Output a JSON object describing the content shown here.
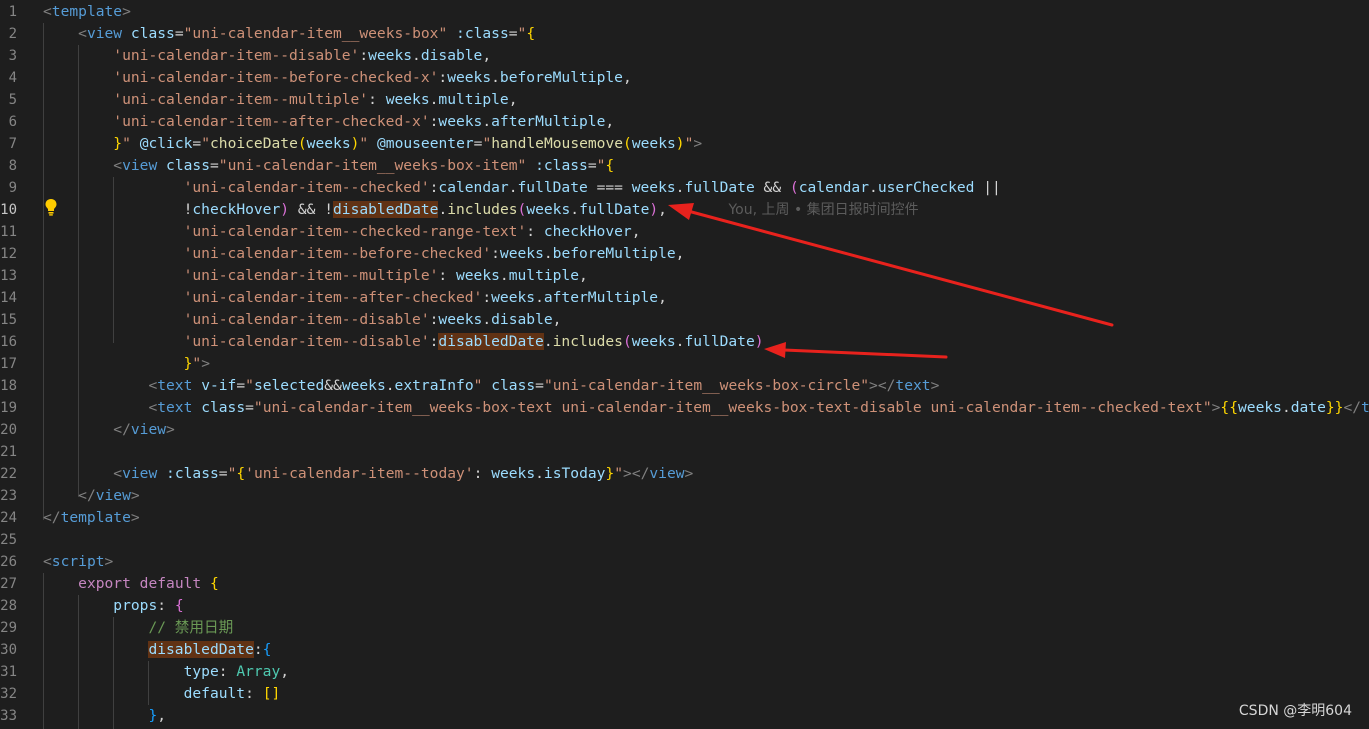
{
  "editor": {
    "active_line": "10",
    "blame_annotation": "You, 上周 • 集团日报时间控件",
    "watermark": "CSDN @李明604",
    "highlight_color": "#613214",
    "arrow_color": "#e8221d",
    "lines": [
      {
        "n": "1",
        "tokens": [
          [
            "t-punc",
            "<"
          ],
          [
            "t-tag",
            "template"
          ],
          [
            "t-punc",
            ">"
          ]
        ]
      },
      {
        "n": "2",
        "tokens": [
          [
            "t-text",
            "    "
          ],
          [
            "t-punc",
            "<"
          ],
          [
            "t-tag",
            "view"
          ],
          [
            "t-text",
            " "
          ],
          [
            "t-attr",
            "class"
          ],
          [
            "t-text",
            "="
          ],
          [
            "t-str",
            "\"uni-calendar-item__weeks-box\""
          ],
          [
            "t-text",
            " "
          ],
          [
            "t-attr",
            ":class"
          ],
          [
            "t-text",
            "="
          ],
          [
            "t-str",
            "\""
          ],
          [
            "t-br1",
            "{"
          ]
        ]
      },
      {
        "n": "3",
        "tokens": [
          [
            "t-text",
            "        "
          ],
          [
            "t-str",
            "'uni-calendar-item--disable'"
          ],
          [
            "t-text",
            ":"
          ],
          [
            "t-var",
            "weeks"
          ],
          [
            "t-text",
            "."
          ],
          [
            "t-prop",
            "disable"
          ],
          [
            "t-text",
            ","
          ]
        ]
      },
      {
        "n": "4",
        "tokens": [
          [
            "t-text",
            "        "
          ],
          [
            "t-str",
            "'uni-calendar-item--before-checked-x'"
          ],
          [
            "t-text",
            ":"
          ],
          [
            "t-var",
            "weeks"
          ],
          [
            "t-text",
            "."
          ],
          [
            "t-prop",
            "beforeMultiple"
          ],
          [
            "t-text",
            ","
          ]
        ]
      },
      {
        "n": "5",
        "tokens": [
          [
            "t-text",
            "        "
          ],
          [
            "t-str",
            "'uni-calendar-item--multiple'"
          ],
          [
            "t-text",
            ": "
          ],
          [
            "t-var",
            "weeks"
          ],
          [
            "t-text",
            "."
          ],
          [
            "t-prop",
            "multiple"
          ],
          [
            "t-text",
            ","
          ]
        ]
      },
      {
        "n": "6",
        "tokens": [
          [
            "t-text",
            "        "
          ],
          [
            "t-str",
            "'uni-calendar-item--after-checked-x'"
          ],
          [
            "t-text",
            ":"
          ],
          [
            "t-var",
            "weeks"
          ],
          [
            "t-text",
            "."
          ],
          [
            "t-prop",
            "afterMultiple"
          ],
          [
            "t-text",
            ","
          ]
        ]
      },
      {
        "n": "7",
        "tokens": [
          [
            "t-text",
            "        "
          ],
          [
            "t-br1",
            "}"
          ],
          [
            "t-str",
            "\""
          ],
          [
            "t-text",
            " "
          ],
          [
            "t-attr",
            "@click"
          ],
          [
            "t-text",
            "="
          ],
          [
            "t-str",
            "\""
          ],
          [
            "t-fn",
            "choiceDate"
          ],
          [
            "t-br1",
            "("
          ],
          [
            "t-var",
            "weeks"
          ],
          [
            "t-br1",
            ")"
          ],
          [
            "t-str",
            "\""
          ],
          [
            "t-text",
            " "
          ],
          [
            "t-attr",
            "@mouseenter"
          ],
          [
            "t-text",
            "="
          ],
          [
            "t-str",
            "\""
          ],
          [
            "t-fn",
            "handleMousemove"
          ],
          [
            "t-br1",
            "("
          ],
          [
            "t-var",
            "weeks"
          ],
          [
            "t-br1",
            ")"
          ],
          [
            "t-str",
            "\""
          ],
          [
            "t-punc",
            ">"
          ]
        ]
      },
      {
        "n": "8",
        "tokens": [
          [
            "t-text",
            "        "
          ],
          [
            "t-punc",
            "<"
          ],
          [
            "t-tag",
            "view"
          ],
          [
            "t-text",
            " "
          ],
          [
            "t-attr",
            "class"
          ],
          [
            "t-text",
            "="
          ],
          [
            "t-str",
            "\"uni-calendar-item__weeks-box-item\""
          ],
          [
            "t-text",
            " "
          ],
          [
            "t-attr",
            ":class"
          ],
          [
            "t-text",
            "="
          ],
          [
            "t-str",
            "\""
          ],
          [
            "t-br1",
            "{"
          ]
        ]
      },
      {
        "n": "9",
        "tokens": [
          [
            "t-text",
            "                "
          ],
          [
            "t-str",
            "'uni-calendar-item--checked'"
          ],
          [
            "t-text",
            ":"
          ],
          [
            "t-var",
            "calendar"
          ],
          [
            "t-text",
            "."
          ],
          [
            "t-prop",
            "fullDate"
          ],
          [
            "t-text",
            " === "
          ],
          [
            "t-var",
            "weeks"
          ],
          [
            "t-text",
            "."
          ],
          [
            "t-prop",
            "fullDate"
          ],
          [
            "t-text",
            " && "
          ],
          [
            "t-br2",
            "("
          ],
          [
            "t-var",
            "calendar"
          ],
          [
            "t-text",
            "."
          ],
          [
            "t-prop",
            "userChecked"
          ],
          [
            "t-text",
            " ||"
          ]
        ]
      },
      {
        "n": "10",
        "tokens": [
          [
            "t-text",
            "                "
          ],
          [
            "t-text",
            "!"
          ],
          [
            "t-var",
            "checkHover"
          ],
          [
            "t-br2",
            ")"
          ],
          [
            "t-text",
            " && !"
          ],
          [
            "t-var t-hl",
            "disabledDate"
          ],
          [
            "t-text",
            "."
          ],
          [
            "t-fn",
            "includes"
          ],
          [
            "t-br2",
            "("
          ],
          [
            "t-var",
            "weeks"
          ],
          [
            "t-text",
            "."
          ],
          [
            "t-prop",
            "fullDate"
          ],
          [
            "t-br2",
            ")"
          ],
          [
            "t-text",
            ","
          ],
          [
            "t-text",
            "       "
          ],
          [
            "blame",
            "You, 上周 • 集团日报时间控件"
          ]
        ]
      },
      {
        "n": "11",
        "tokens": [
          [
            "t-text",
            "                "
          ],
          [
            "t-str",
            "'uni-calendar-item--checked-range-text'"
          ],
          [
            "t-text",
            ": "
          ],
          [
            "t-var",
            "checkHover"
          ],
          [
            "t-text",
            ","
          ]
        ]
      },
      {
        "n": "12",
        "tokens": [
          [
            "t-text",
            "                "
          ],
          [
            "t-str",
            "'uni-calendar-item--before-checked'"
          ],
          [
            "t-text",
            ":"
          ],
          [
            "t-var",
            "weeks"
          ],
          [
            "t-text",
            "."
          ],
          [
            "t-prop",
            "beforeMultiple"
          ],
          [
            "t-text",
            ","
          ]
        ]
      },
      {
        "n": "13",
        "tokens": [
          [
            "t-text",
            "                "
          ],
          [
            "t-str",
            "'uni-calendar-item--multiple'"
          ],
          [
            "t-text",
            ": "
          ],
          [
            "t-var",
            "weeks"
          ],
          [
            "t-text",
            "."
          ],
          [
            "t-prop",
            "multiple"
          ],
          [
            "t-text",
            ","
          ]
        ]
      },
      {
        "n": "14",
        "tokens": [
          [
            "t-text",
            "                "
          ],
          [
            "t-str",
            "'uni-calendar-item--after-checked'"
          ],
          [
            "t-text",
            ":"
          ],
          [
            "t-var",
            "weeks"
          ],
          [
            "t-text",
            "."
          ],
          [
            "t-prop",
            "afterMultiple"
          ],
          [
            "t-text",
            ","
          ]
        ]
      },
      {
        "n": "15",
        "tokens": [
          [
            "t-text",
            "                "
          ],
          [
            "t-str",
            "'uni-calendar-item--disable'"
          ],
          [
            "t-text",
            ":"
          ],
          [
            "t-var",
            "weeks"
          ],
          [
            "t-text",
            "."
          ],
          [
            "t-prop",
            "disable"
          ],
          [
            "t-text",
            ","
          ]
        ]
      },
      {
        "n": "16",
        "tokens": [
          [
            "t-text",
            "                "
          ],
          [
            "t-str",
            "'uni-calendar-item--disable'"
          ],
          [
            "t-text",
            ":"
          ],
          [
            "t-var t-hl",
            "disabledDate"
          ],
          [
            "t-text",
            "."
          ],
          [
            "t-fn",
            "includes"
          ],
          [
            "t-br2",
            "("
          ],
          [
            "t-var",
            "weeks"
          ],
          [
            "t-text",
            "."
          ],
          [
            "t-prop",
            "fullDate"
          ],
          [
            "t-br2",
            ")"
          ]
        ]
      },
      {
        "n": "17",
        "tokens": [
          [
            "t-text",
            "                "
          ],
          [
            "t-br1",
            "}"
          ],
          [
            "t-str",
            "\""
          ],
          [
            "t-punc",
            ">"
          ]
        ]
      },
      {
        "n": "18",
        "tokens": [
          [
            "t-text",
            "            "
          ],
          [
            "t-punc",
            "<"
          ],
          [
            "t-tag",
            "text"
          ],
          [
            "t-text",
            " "
          ],
          [
            "t-attr",
            "v-if"
          ],
          [
            "t-text",
            "="
          ],
          [
            "t-str",
            "\""
          ],
          [
            "t-var",
            "selected"
          ],
          [
            "t-text",
            "&&"
          ],
          [
            "t-var",
            "weeks"
          ],
          [
            "t-text",
            "."
          ],
          [
            "t-prop",
            "extraInfo"
          ],
          [
            "t-str",
            "\""
          ],
          [
            "t-text",
            " "
          ],
          [
            "t-attr",
            "class"
          ],
          [
            "t-text",
            "="
          ],
          [
            "t-str",
            "\"uni-calendar-item__weeks-box-circle\""
          ],
          [
            "t-punc",
            "></"
          ],
          [
            "t-tag",
            "text"
          ],
          [
            "t-punc",
            ">"
          ]
        ]
      },
      {
        "n": "19",
        "tokens": [
          [
            "t-text",
            "            "
          ],
          [
            "t-punc",
            "<"
          ],
          [
            "t-tag",
            "text"
          ],
          [
            "t-text",
            " "
          ],
          [
            "t-attr",
            "class"
          ],
          [
            "t-text",
            "="
          ],
          [
            "t-str",
            "\"uni-calendar-item__weeks-box-text uni-calendar-item__weeks-box-text-disable uni-calendar-item--checked-text\""
          ],
          [
            "t-punc",
            ">"
          ],
          [
            "t-br1",
            "{{"
          ],
          [
            "t-var",
            "weeks"
          ],
          [
            "t-text",
            "."
          ],
          [
            "t-prop",
            "date"
          ],
          [
            "t-br1",
            "}}"
          ],
          [
            "t-punc",
            "</"
          ],
          [
            "t-tag",
            "text"
          ],
          [
            "t-punc",
            ">"
          ]
        ]
      },
      {
        "n": "20",
        "tokens": [
          [
            "t-text",
            "        "
          ],
          [
            "t-punc",
            "</"
          ],
          [
            "t-tag",
            "view"
          ],
          [
            "t-punc",
            ">"
          ]
        ]
      },
      {
        "n": "21",
        "tokens": []
      },
      {
        "n": "22",
        "tokens": [
          [
            "t-text",
            "        "
          ],
          [
            "t-punc",
            "<"
          ],
          [
            "t-tag",
            "view"
          ],
          [
            "t-text",
            " "
          ],
          [
            "t-attr",
            ":class"
          ],
          [
            "t-text",
            "="
          ],
          [
            "t-str",
            "\""
          ],
          [
            "t-br1",
            "{"
          ],
          [
            "t-str",
            "'uni-calendar-item--today'"
          ],
          [
            "t-text",
            ": "
          ],
          [
            "t-var",
            "weeks"
          ],
          [
            "t-text",
            "."
          ],
          [
            "t-prop",
            "isToday"
          ],
          [
            "t-br1",
            "}"
          ],
          [
            "t-str",
            "\""
          ],
          [
            "t-punc",
            "></"
          ],
          [
            "t-tag",
            "view"
          ],
          [
            "t-punc",
            ">"
          ]
        ]
      },
      {
        "n": "23",
        "tokens": [
          [
            "t-text",
            "    "
          ],
          [
            "t-punc",
            "</"
          ],
          [
            "t-tag",
            "view"
          ],
          [
            "t-punc",
            ">"
          ]
        ]
      },
      {
        "n": "24",
        "tokens": [
          [
            "t-punc",
            "</"
          ],
          [
            "t-tag",
            "template"
          ],
          [
            "t-punc",
            ">"
          ]
        ]
      },
      {
        "n": "25",
        "tokens": []
      },
      {
        "n": "26",
        "tokens": [
          [
            "t-punc",
            "<"
          ],
          [
            "t-tag",
            "script"
          ],
          [
            "t-punc",
            ">"
          ]
        ]
      },
      {
        "n": "27",
        "tokens": [
          [
            "t-text",
            "    "
          ],
          [
            "t-kw",
            "export"
          ],
          [
            "t-text",
            " "
          ],
          [
            "t-kw",
            "default"
          ],
          [
            "t-text",
            " "
          ],
          [
            "t-br1",
            "{"
          ]
        ]
      },
      {
        "n": "28",
        "tokens": [
          [
            "t-text",
            "        "
          ],
          [
            "t-var",
            "props"
          ],
          [
            "t-text",
            ": "
          ],
          [
            "t-br2",
            "{"
          ]
        ]
      },
      {
        "n": "29",
        "tokens": [
          [
            "t-text",
            "            "
          ],
          [
            "t-comment",
            "// 禁用日期"
          ]
        ]
      },
      {
        "n": "30",
        "tokens": [
          [
            "t-text",
            "            "
          ],
          [
            "t-var t-hl",
            "disabledDate"
          ],
          [
            "t-text",
            ":"
          ],
          [
            "t-br3",
            "{"
          ]
        ]
      },
      {
        "n": "31",
        "tokens": [
          [
            "t-text",
            "                "
          ],
          [
            "t-var",
            "type"
          ],
          [
            "t-text",
            ": "
          ],
          [
            "t-cls",
            "Array"
          ],
          [
            "t-text",
            ","
          ]
        ]
      },
      {
        "n": "32",
        "tokens": [
          [
            "t-text",
            "                "
          ],
          [
            "t-var",
            "default"
          ],
          [
            "t-text",
            ": "
          ],
          [
            "t-br1",
            "[]"
          ]
        ]
      },
      {
        "n": "33",
        "tokens": [
          [
            "t-text",
            "            "
          ],
          [
            "t-br3",
            "}"
          ],
          [
            "t-text",
            ","
          ]
        ]
      }
    ]
  }
}
